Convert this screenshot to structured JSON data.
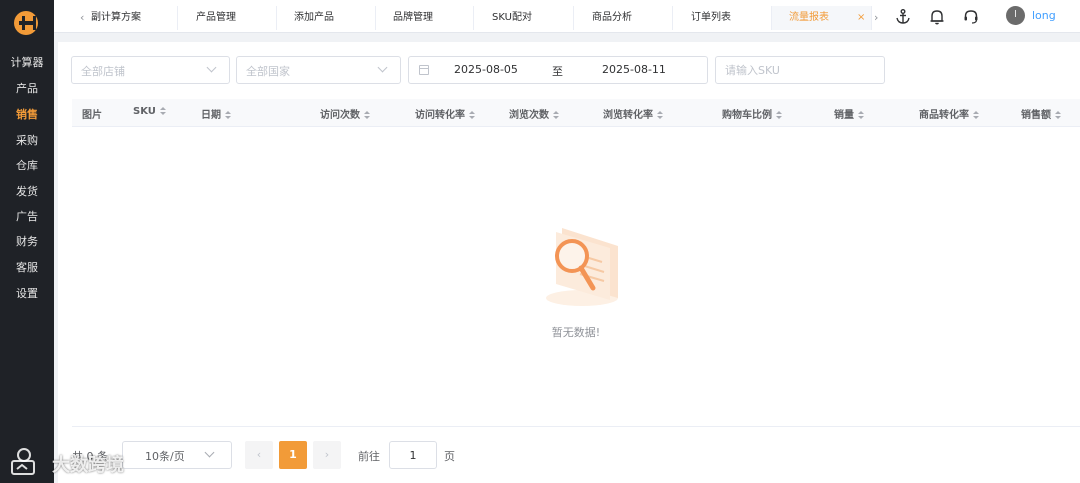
{
  "sidebar": {
    "items": [
      {
        "label": "计算器"
      },
      {
        "label": "产品"
      },
      {
        "label": "销售"
      },
      {
        "label": "采购"
      },
      {
        "label": "仓库"
      },
      {
        "label": "发货"
      },
      {
        "label": "广告"
      },
      {
        "label": "财务"
      },
      {
        "label": "客服"
      },
      {
        "label": "设置"
      }
    ],
    "active": "销售"
  },
  "tabs": [
    {
      "label": "副计算方案"
    },
    {
      "label": "产品管理"
    },
    {
      "label": "添加产品"
    },
    {
      "label": "品牌管理"
    },
    {
      "label": "SKU配对"
    },
    {
      "label": "商品分析"
    },
    {
      "label": "订单列表"
    },
    {
      "label": "流量报表",
      "active": true
    }
  ],
  "tab_close": "×",
  "nav_arrows": {
    "left": "‹",
    "right": "›"
  },
  "header": {
    "icons": [
      "anchor-icon",
      "bell-icon",
      "headset-icon"
    ],
    "avatar_initial": "l",
    "username": "long"
  },
  "filters": {
    "store_placeholder": "全部店铺",
    "country_placeholder": "全部国家",
    "date_start": "2025-08-05",
    "date_separator": "至",
    "date_end": "2025-08-11",
    "sku_placeholder": "请输入SKU"
  },
  "table": {
    "columns": [
      "图片",
      "SKU",
      "日期",
      "访问次数",
      "访问转化率",
      "浏览次数",
      "浏览转化率",
      "购物车比例",
      "销量",
      "商品转化率",
      "销售额"
    ],
    "rows": [],
    "empty_text": "暂无数据!"
  },
  "pagination": {
    "total_label": "共 0 条",
    "page_size": "10条/页",
    "prev": "‹",
    "current_page": "1",
    "next": "›",
    "goto_prefix": "前往",
    "goto_value": "1",
    "goto_suffix": "页"
  },
  "watermark": {
    "text": "大数跨境"
  },
  "colors": {
    "sidebar_bg": "#1f2227",
    "accent": "#f29b38",
    "link": "#409eff"
  }
}
